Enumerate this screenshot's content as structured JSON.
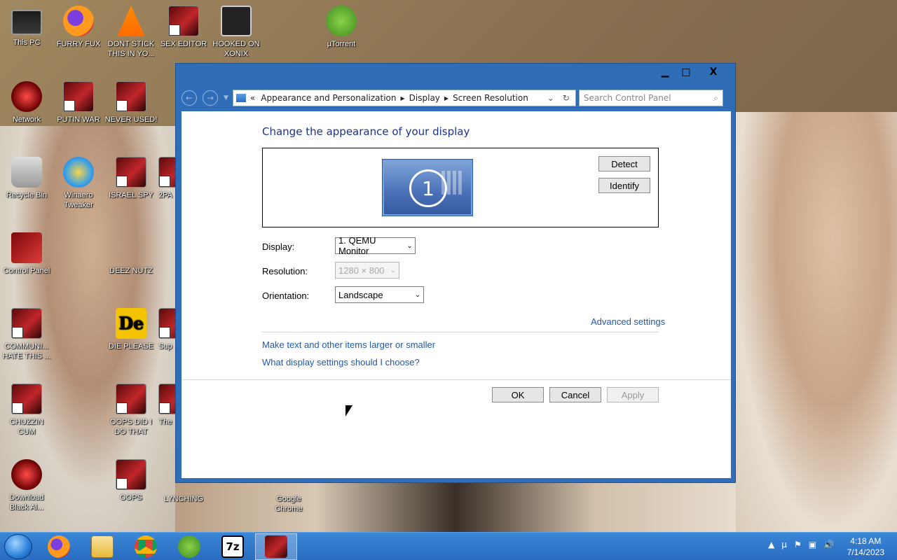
{
  "desktop": {
    "icons": [
      {
        "label": "This PC",
        "icon": "computer-icon"
      },
      {
        "label": "FURRY FUX",
        "icon": "firefox-icon"
      },
      {
        "label": "DONT STICK THIS IN YO...",
        "icon": "vlc-icon"
      },
      {
        "label": "SEX EDITOR",
        "icon": "app-icon"
      },
      {
        "label": "HOOKED ON XONIX",
        "icon": "app-icon"
      },
      {
        "label": "µTorrent",
        "icon": "utorrent-icon"
      },
      {
        "label": "Network",
        "icon": "network-icon"
      },
      {
        "label": "PUTIN WAR",
        "icon": "app-icon"
      },
      {
        "label": "NEVER USED!",
        "icon": "app-icon"
      },
      {
        "label": "Recycle Bin",
        "icon": "recycle-bin-icon"
      },
      {
        "label": "Winaero Tweaker",
        "icon": "winaero-icon"
      },
      {
        "label": "ISRAEL SPY",
        "icon": "app-icon"
      },
      {
        "label": "2PA",
        "icon": "app-icon"
      },
      {
        "label": "Control Panel",
        "icon": "control-panel-icon"
      },
      {
        "label": "DEEZ NUTZ",
        "icon": "windows-icon"
      },
      {
        "label": "COMMUNI... HATE THIS ...",
        "icon": "app-icon"
      },
      {
        "label": "DIE PLEASE",
        "icon": "app-icon"
      },
      {
        "label": "Sup",
        "icon": "app-icon"
      },
      {
        "label": "CHUZZIN CUM",
        "icon": "app-icon"
      },
      {
        "label": "OOPS DID I DO THAT",
        "icon": "app-icon"
      },
      {
        "label": "The",
        "icon": "app-icon"
      },
      {
        "label": "Download Black Al...",
        "icon": "app-icon"
      },
      {
        "label": "OOPS",
        "icon": "app-icon"
      },
      {
        "label": "LYNCHING",
        "icon": "app-icon"
      },
      {
        "label": "Google Chrome",
        "icon": "chrome-icon"
      }
    ]
  },
  "window": {
    "minimize": "▁",
    "maximize": "□",
    "close": "X",
    "breadcrumb": {
      "prefix": "«",
      "items": [
        "Appearance and Personalization",
        "Display",
        "Screen Resolution"
      ],
      "separator": "▶"
    },
    "search_placeholder": "Search Control Panel",
    "heading": "Change the appearance of your display",
    "monitor_number": "1",
    "detect_label": "Detect",
    "identify_label": "Identify",
    "display_label": "Display:",
    "display_value": "1. QEMU Monitor",
    "resolution_label": "Resolution:",
    "resolution_value": "1280 × 800",
    "orientation_label": "Orientation:",
    "orientation_value": "Landscape",
    "advanced_link": "Advanced settings",
    "text_size_link": "Make text and other items larger or smaller",
    "help_link": "What display settings should I choose?",
    "ok_label": "OK",
    "cancel_label": "Cancel",
    "apply_label": "Apply"
  },
  "taskbar": {
    "items": [
      "firefox-icon",
      "file-explorer-icon",
      "chrome-icon",
      "utorrent-icon",
      "7zip-icon",
      "app-icon"
    ],
    "sevenzip_text": "7z",
    "time": "4:18 AM",
    "date": "7/14/2023"
  },
  "colors": {
    "window_frame": "#2f6db8",
    "heading": "#1e3287",
    "link": "#1e5aa8",
    "taskbar": "#2a6cc0"
  }
}
